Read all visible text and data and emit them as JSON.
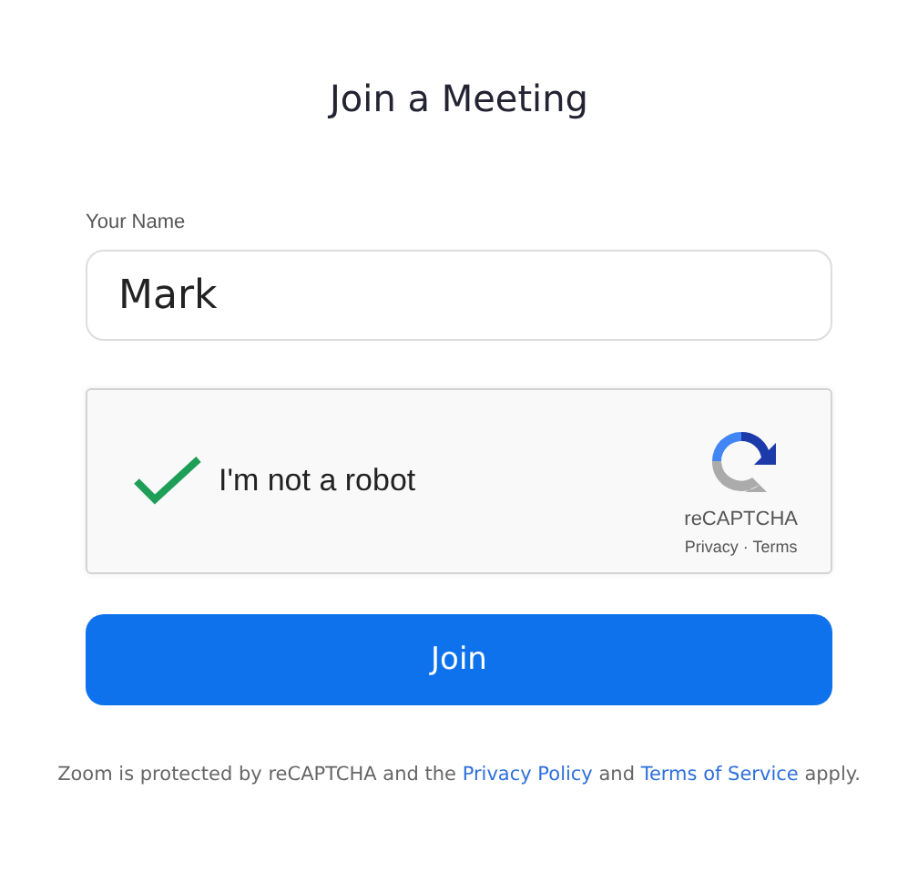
{
  "title": "Join a Meeting",
  "name_field": {
    "label": "Your Name",
    "value": "Mark"
  },
  "captcha": {
    "label": "I'm not a robot",
    "checked": true,
    "brand": "reCAPTCHA",
    "privacy": "Privacy",
    "separator": "·",
    "terms": "Terms"
  },
  "join_button": "Join",
  "footer": [
    {
      "kind": "text",
      "text": "Zoom is protected by reCAPTCHA and the "
    },
    {
      "kind": "link",
      "text": "Privacy Policy"
    },
    {
      "kind": "text",
      "text": " and "
    },
    {
      "kind": "link",
      "text": "Terms of Service"
    },
    {
      "kind": "text",
      "text": " apply."
    }
  ]
}
